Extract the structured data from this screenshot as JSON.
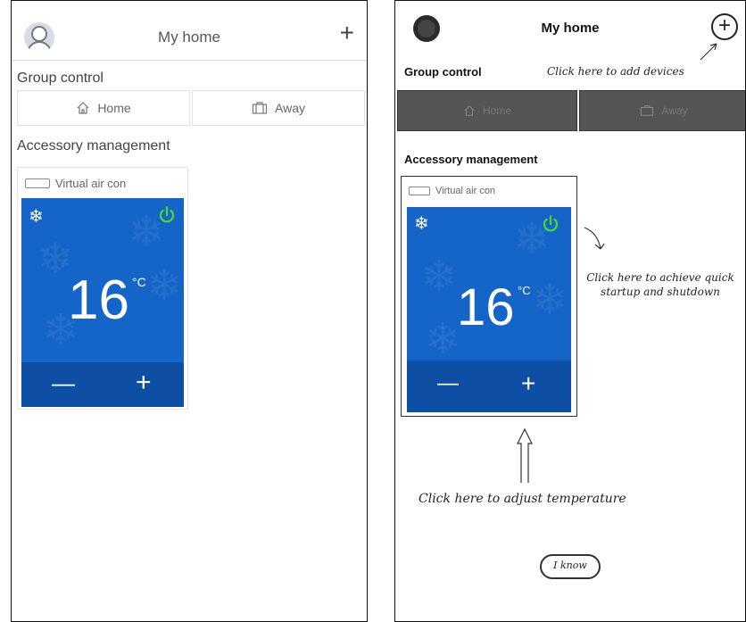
{
  "left": {
    "header": {
      "title": "My home",
      "add_icon": "+"
    },
    "group_control": {
      "title": "Group control",
      "home_label": "Home",
      "away_label": "Away"
    },
    "accessory": {
      "title": "Accessory management",
      "device_name": "Virtual air con",
      "temperature": "16",
      "unit": "°C",
      "minus": "—",
      "plus": "+"
    }
  },
  "right": {
    "header": {
      "title": "My home",
      "add_icon": "+"
    },
    "group_control": {
      "title": "Group control",
      "home_label": "Home",
      "away_label": "Away"
    },
    "accessory": {
      "title": "Accessory management",
      "device_name": "Virtual air con",
      "temperature": "16",
      "unit": "°C",
      "minus": "—",
      "plus": "+"
    },
    "hints": {
      "add_devices": "Click here to add devices",
      "power": "Click here to achieve quick startup and shutdown",
      "temperature": "Click here to adjust temperature",
      "dismiss": "I know"
    }
  },
  "colors": {
    "tile_blue": "#1565c8",
    "tile_dark": "#0e4fa5",
    "power_green": "#4cd137"
  },
  "icons": [
    "avatar-icon",
    "plus-icon",
    "home-icon",
    "suitcase-icon",
    "air-con-icon",
    "snowflake-icon",
    "power-icon"
  ]
}
